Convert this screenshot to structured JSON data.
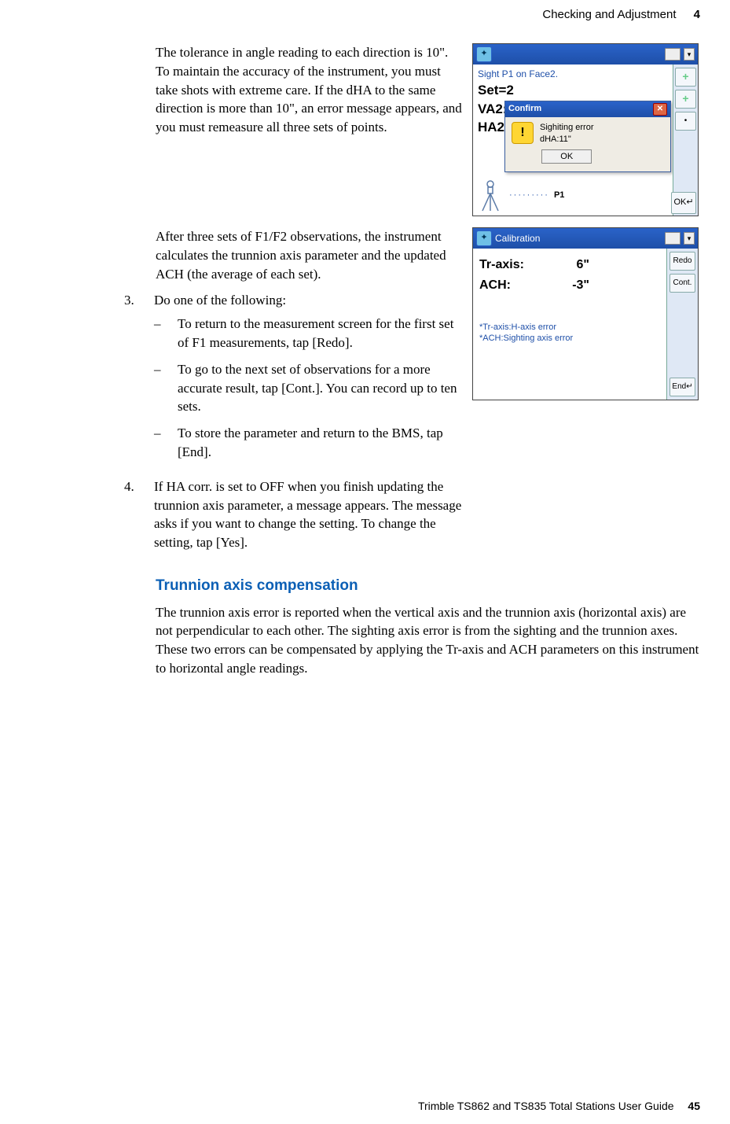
{
  "header": {
    "section": "Checking and Adjustment",
    "chapter": "4"
  },
  "block1": {
    "para": "The tolerance in angle reading to each direction is 10\". To maintain the accuracy of the instrument, you must take shots with extreme care. If the dHA to the same direction is more than 10\", an error message appears, and you must remeasure all three sets of points."
  },
  "fig1": {
    "hint": "Sight P1 on Face2.",
    "set": "Set=2",
    "va": "VA2:",
    "ha": "HA2:",
    "dlg_title": "Confirm",
    "dlg_line1": "Sighiting error",
    "dlg_line2": "dHA:11\"",
    "dlg_ok": "OK",
    "p1": "P1",
    "okbtn": "OK↵"
  },
  "block2": {
    "para": "After three sets of F1/F2 observations, the instrument calculates the trunnion axis parameter and the updated ACH (the average of each set)."
  },
  "steps": {
    "s3": "Do one of the following:",
    "s3a": "To return to the measurement screen for the first set of F1 measurements, tap [Redo].",
    "s3b": "To go to the next set of observations for a more accurate result, tap [Cont.]. You can record up to ten sets.",
    "s3c": "To store the parameter and return to the BMS, tap [End].",
    "s4": "If HA corr. is set to OFF when you finish updating the trunnion axis parameter, a message appears. The message asks if you want to change the setting. To change the setting, tap [Yes]."
  },
  "fig2": {
    "title": "Calibration",
    "tr_lbl": "Tr-axis:",
    "tr_val": "6\"",
    "ach_lbl": "ACH:",
    "ach_val": "-3\"",
    "fn1": "*Tr-axis:H-axis error",
    "fn2": "*ACH:Sighting axis error",
    "btn_redo": "Redo",
    "btn_cont": "Cont.",
    "btn_end": "End↵"
  },
  "subhead": "Trunnion axis compensation",
  "body2": "The trunnion axis error is reported when the vertical axis and the trunnion axis (horizontal axis) are not perpendicular to each other. The sighting axis error is from the sighting and the trunnion axes. These two errors can be compensated by applying the Tr-axis and ACH parameters on this instrument to horizontal angle readings.",
  "footer": {
    "guide": "Trimble TS862 and TS835 Total Stations User Guide",
    "page": "45"
  }
}
